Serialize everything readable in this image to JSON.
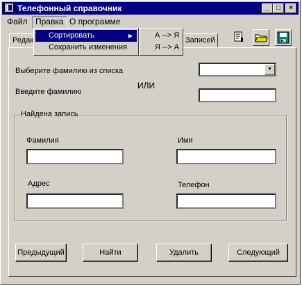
{
  "window": {
    "title": "Телефонный справочник",
    "controls": {
      "minimize": "_",
      "maximize": "□",
      "close": "×"
    }
  },
  "menubar": {
    "items": [
      {
        "label": "Файл"
      },
      {
        "label": "Правка"
      },
      {
        "label": "О программе"
      }
    ]
  },
  "edit_menu": {
    "items": [
      {
        "label": "Сортировать",
        "has_submenu": true
      },
      {
        "label": "Сохранить изменения"
      }
    ],
    "submenu_arrow": "▶"
  },
  "sort_submenu": {
    "items": [
      {
        "label": "А --> Я"
      },
      {
        "label": "Я --> А"
      }
    ]
  },
  "tabs": [
    {
      "label": "Редактирование"
    },
    {
      "label": "Записей"
    }
  ],
  "toolbar": {
    "icons": [
      "properties-icon",
      "open-folder-icon",
      "save-disk-icon"
    ]
  },
  "form": {
    "choose_label": "Выберите фамилию из списка",
    "or_label": "ИЛИ",
    "enter_label": "Введите фамилию",
    "combo_value": "",
    "combo_arrow": "▼",
    "surname_input_value": ""
  },
  "record": {
    "group_title": "Найдена запись",
    "fields": {
      "lastname": {
        "label": "Фамилия",
        "value": ""
      },
      "firstname": {
        "label": "Имя",
        "value": ""
      },
      "address": {
        "label": "Адрес",
        "value": ""
      },
      "phone": {
        "label": "Телефон",
        "value": ""
      }
    }
  },
  "buttons": {
    "previous": "Предыдущий",
    "find": "Найти",
    "delete": "Удалить",
    "next": "Следующий"
  },
  "colors": {
    "titlebar": "#000080",
    "face": "#d4d0c8",
    "highlight": "#000080"
  }
}
